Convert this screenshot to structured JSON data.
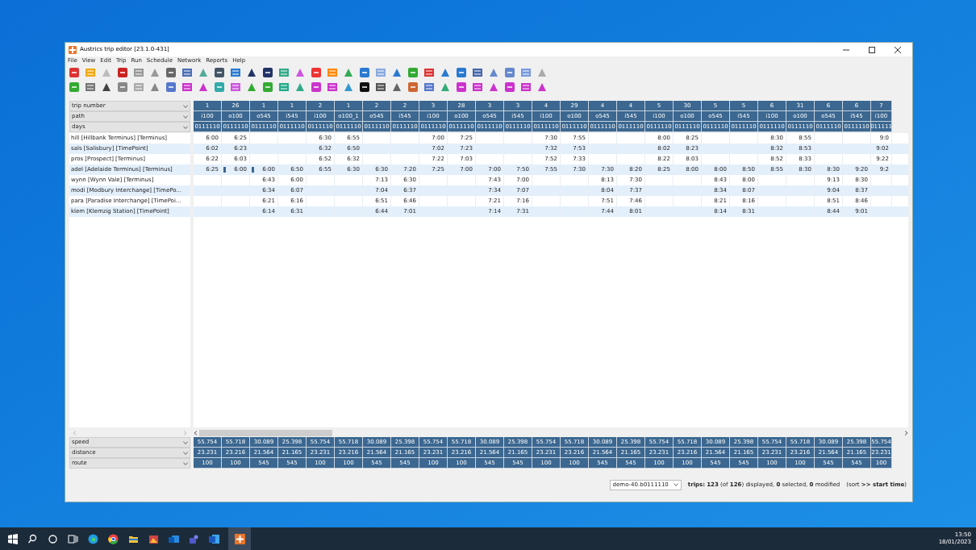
{
  "window": {
    "title": "Austrics trip editor [23.1.0-431]"
  },
  "menu": [
    "File",
    "View",
    "Edit",
    "Trip",
    "Run",
    "Schedule",
    "Network",
    "Reports",
    "Help"
  ],
  "header_rows": [
    {
      "label": "trip number"
    },
    {
      "label": "path"
    },
    {
      "label": "days"
    }
  ],
  "stops": [
    "hill [Hillbank Terminus] [Terminus]",
    "sals [Salisbury] [TimePoint]",
    "pros [Prospect] [Terminus]",
    "adel [Adelaide Terminus] [Terminus]",
    "wynn [Wynn Vale] [Terminus]",
    "modi [Modbury Interchange] [TimePo...",
    "para [Paradise Interchange] [TimePoi...",
    "klem [Klemzig Station] [TimePoint]"
  ],
  "footer_rows": [
    {
      "label": "speed"
    },
    {
      "label": "distance"
    },
    {
      "label": "route"
    }
  ],
  "trips": [
    {
      "number": "1",
      "path": "i100",
      "days": "0111110",
      "kind": "upper",
      "times": [
        "6:00",
        "6:02",
        "6:22",
        "6:25"
      ],
      "marked": false,
      "speed": "55.754",
      "distance": "23.231",
      "route": "100"
    },
    {
      "number": "26",
      "path": "o100",
      "days": "0111110",
      "kind": "upper",
      "times": [
        "6:25",
        "6:23",
        "6:03",
        "6:00"
      ],
      "marked": true,
      "speed": "55.718",
      "distance": "23.216",
      "route": "100"
    },
    {
      "number": "1",
      "path": "o545",
      "days": "0111110",
      "kind": "lower",
      "times": [
        "6:00",
        "6:43",
        "6:34",
        "6:21",
        "6:14"
      ],
      "marked": true,
      "speed": "30.089",
      "distance": "21.564",
      "route": "545"
    },
    {
      "number": "1",
      "path": "i545",
      "days": "0111110",
      "kind": "lower",
      "times": [
        "6:50",
        "6:00",
        "6:07",
        "6:16",
        "6:31"
      ],
      "marked": false,
      "speed": "25.398",
      "distance": "21.165",
      "route": "545"
    },
    {
      "number": "2",
      "path": "i100",
      "days": "0111110",
      "kind": "upper",
      "times": [
        "6:30",
        "6:32",
        "6:52",
        "6:55"
      ],
      "marked": false,
      "speed": "55.754",
      "distance": "23.231",
      "route": "100"
    },
    {
      "number": "1",
      "path": "o100_1",
      "days": "0111110",
      "kind": "upper",
      "times": [
        "6:55",
        "6:50",
        "6:32",
        "6:30"
      ],
      "marked": false,
      "speed": "55.718",
      "distance": "23.216",
      "route": "100"
    },
    {
      "number": "2",
      "path": "o545",
      "days": "0111110",
      "kind": "lower",
      "times": [
        "6:30",
        "7:13",
        "7:04",
        "6:51",
        "6:44"
      ],
      "marked": false,
      "speed": "30.089",
      "distance": "21.564",
      "route": "545"
    },
    {
      "number": "2",
      "path": "i545",
      "days": "0111110",
      "kind": "lower",
      "times": [
        "7:20",
        "6:30",
        "6:37",
        "6:46",
        "7:01"
      ],
      "marked": false,
      "speed": "25.398",
      "distance": "21.165",
      "route": "545"
    },
    {
      "number": "3",
      "path": "i100",
      "days": "0111110",
      "kind": "upper",
      "times": [
        "7:00",
        "7:02",
        "7:22",
        "7:25"
      ],
      "marked": false,
      "speed": "55.754",
      "distance": "23.231",
      "route": "100"
    },
    {
      "number": "28",
      "path": "o100",
      "days": "0111110",
      "kind": "upper",
      "times": [
        "7:25",
        "7:23",
        "7:03",
        "7:00"
      ],
      "marked": false,
      "speed": "55.718",
      "distance": "23.216",
      "route": "100"
    },
    {
      "number": "3",
      "path": "o545",
      "days": "0111110",
      "kind": "lower",
      "times": [
        "7:00",
        "7:43",
        "7:34",
        "7:21",
        "7:14"
      ],
      "marked": false,
      "speed": "30.089",
      "distance": "21.564",
      "route": "545"
    },
    {
      "number": "3",
      "path": "i545",
      "days": "0111110",
      "kind": "lower",
      "times": [
        "7:50",
        "7:00",
        "7:07",
        "7:16",
        "7:31"
      ],
      "marked": false,
      "speed": "25.398",
      "distance": "21.165",
      "route": "545"
    },
    {
      "number": "4",
      "path": "i100",
      "days": "0111110",
      "kind": "upper",
      "times": [
        "7:30",
        "7:32",
        "7:52",
        "7:55"
      ],
      "marked": false,
      "speed": "55.754",
      "distance": "23.231",
      "route": "100"
    },
    {
      "number": "29",
      "path": "o100",
      "days": "0111110",
      "kind": "upper",
      "times": [
        "7:55",
        "7:53",
        "7:33",
        "7:30"
      ],
      "marked": false,
      "speed": "55.718",
      "distance": "23.216",
      "route": "100"
    },
    {
      "number": "4",
      "path": "o545",
      "days": "0111110",
      "kind": "lower",
      "times": [
        "7:30",
        "8:13",
        "8:04",
        "7:51",
        "7:44"
      ],
      "marked": false,
      "speed": "30.089",
      "distance": "21.564",
      "route": "545"
    },
    {
      "number": "4",
      "path": "i545",
      "days": "0111110",
      "kind": "lower",
      "times": [
        "8:20",
        "7:30",
        "7:37",
        "7:46",
        "8:01"
      ],
      "marked": false,
      "speed": "25.398",
      "distance": "21.165",
      "route": "545"
    },
    {
      "number": "5",
      "path": "i100",
      "days": "0111110",
      "kind": "upper",
      "times": [
        "8:00",
        "8:02",
        "8:22",
        "8:25"
      ],
      "marked": false,
      "speed": "55.754",
      "distance": "23.231",
      "route": "100"
    },
    {
      "number": "30",
      "path": "o100",
      "days": "0111110",
      "kind": "upper",
      "times": [
        "8:25",
        "8:23",
        "8:03",
        "8:00"
      ],
      "marked": false,
      "speed": "55.718",
      "distance": "23.216",
      "route": "100"
    },
    {
      "number": "5",
      "path": "o545",
      "days": "0111110",
      "kind": "lower",
      "times": [
        "8:00",
        "8:43",
        "8:34",
        "8:21",
        "8:14"
      ],
      "marked": false,
      "speed": "30.089",
      "distance": "21.564",
      "route": "545"
    },
    {
      "number": "5",
      "path": "i545",
      "days": "0111110",
      "kind": "lower",
      "times": [
        "8:50",
        "8:00",
        "8:07",
        "8:16",
        "8:31"
      ],
      "marked": false,
      "speed": "25.398",
      "distance": "21.165",
      "route": "545"
    },
    {
      "number": "6",
      "path": "i100",
      "days": "0111110",
      "kind": "upper",
      "times": [
        "8:30",
        "8:32",
        "8:52",
        "8:55"
      ],
      "marked": false,
      "speed": "55.754",
      "distance": "23.231",
      "route": "100"
    },
    {
      "number": "31",
      "path": "o100",
      "days": "0111110",
      "kind": "upper",
      "times": [
        "8:55",
        "8:53",
        "8:33",
        "8:30"
      ],
      "marked": false,
      "speed": "55.718",
      "distance": "23.216",
      "route": "100"
    },
    {
      "number": "6",
      "path": "o545",
      "days": "0111110",
      "kind": "lower",
      "times": [
        "8:30",
        "9:13",
        "9:04",
        "8:51",
        "8:44"
      ],
      "marked": false,
      "speed": "30.089",
      "distance": "21.564",
      "route": "545"
    },
    {
      "number": "6",
      "path": "i545",
      "days": "0111110",
      "kind": "lower",
      "times": [
        "9:20",
        "8:30",
        "8:37",
        "8:46",
        "9:01"
      ],
      "marked": false,
      "speed": "25.398",
      "distance": "21.165",
      "route": "545"
    },
    {
      "number": "7",
      "path": "i100",
      "days": "011111",
      "kind": "upper",
      "times": [
        "9:0",
        "9:02",
        "9:22",
        "9:2"
      ],
      "marked": false,
      "speed": "55.754",
      "distance": "23.231",
      "route": "100"
    }
  ],
  "status_bar": {
    "dataset": "demo-40.b0111110",
    "summary": "**trips:** **123** (of **126**) displayed, **0** selected, **0** modified",
    "sort": "(sort **>> start time**)"
  },
  "taskbar": {
    "time": "13:50",
    "date": "18/01/2023"
  }
}
